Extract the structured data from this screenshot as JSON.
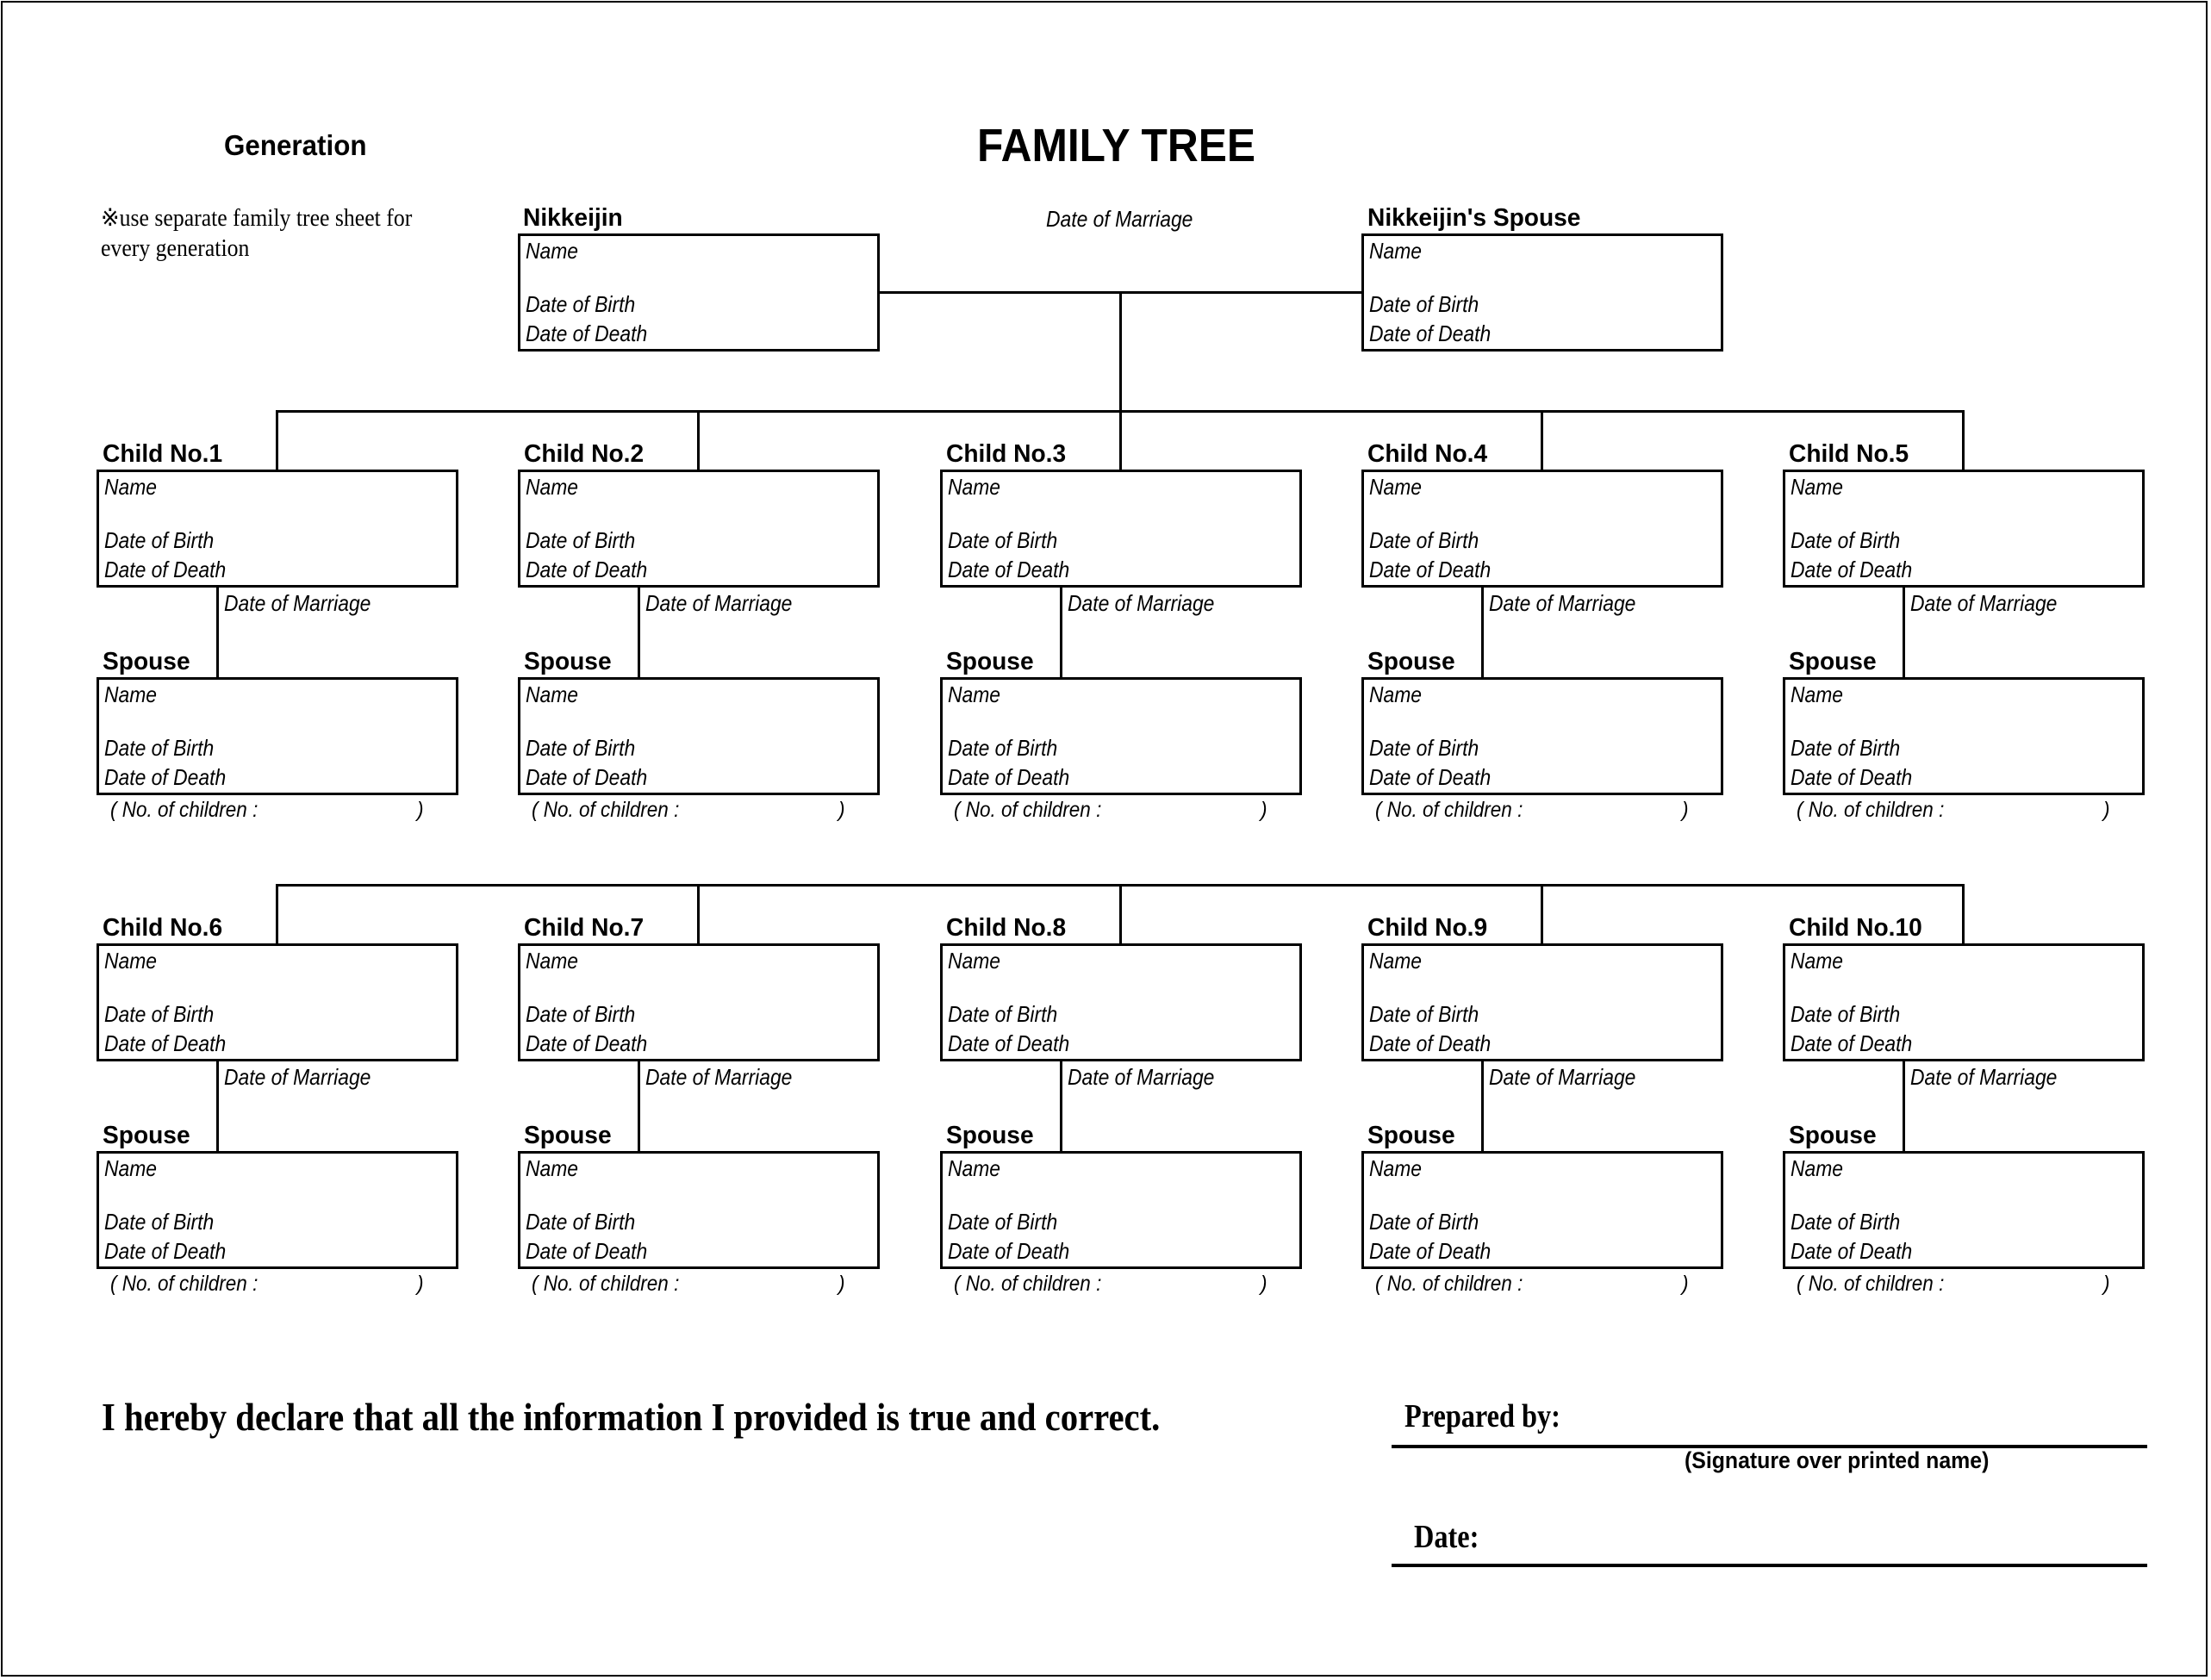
{
  "header": {
    "title": "FAMILY TREE",
    "generation_label": "Generation",
    "note_line1": "※use separate family tree sheet for",
    "note_line2": "every generation"
  },
  "field_labels": {
    "name": "Name",
    "date_of_birth": "Date of Birth",
    "date_of_death": "Date of Death",
    "date_of_marriage": "Date of Marriage",
    "spouse": "Spouse",
    "no_of_children_open": "( No. of children :",
    "no_of_children_close": ")"
  },
  "parents": {
    "nikkeijin_label": "Nikkeijin",
    "spouse_label": "Nikkeijin's Spouse",
    "date_of_marriage": "Date of Marriage"
  },
  "children": [
    {
      "label": "Child No.1"
    },
    {
      "label": "Child No.2"
    },
    {
      "label": "Child No.3"
    },
    {
      "label": "Child No.4"
    },
    {
      "label": "Child No.5"
    },
    {
      "label": "Child No.6"
    },
    {
      "label": "Child No.7"
    },
    {
      "label": "Child No.8"
    },
    {
      "label": "Child No.9"
    },
    {
      "label": "Child No.10"
    }
  ],
  "footer": {
    "declaration": "I hereby declare that all the information I provided is true and correct.",
    "prepared_by_label": "Prepared by:",
    "signature_caption": "(Signature over printed name)",
    "date_label": "Date:"
  }
}
